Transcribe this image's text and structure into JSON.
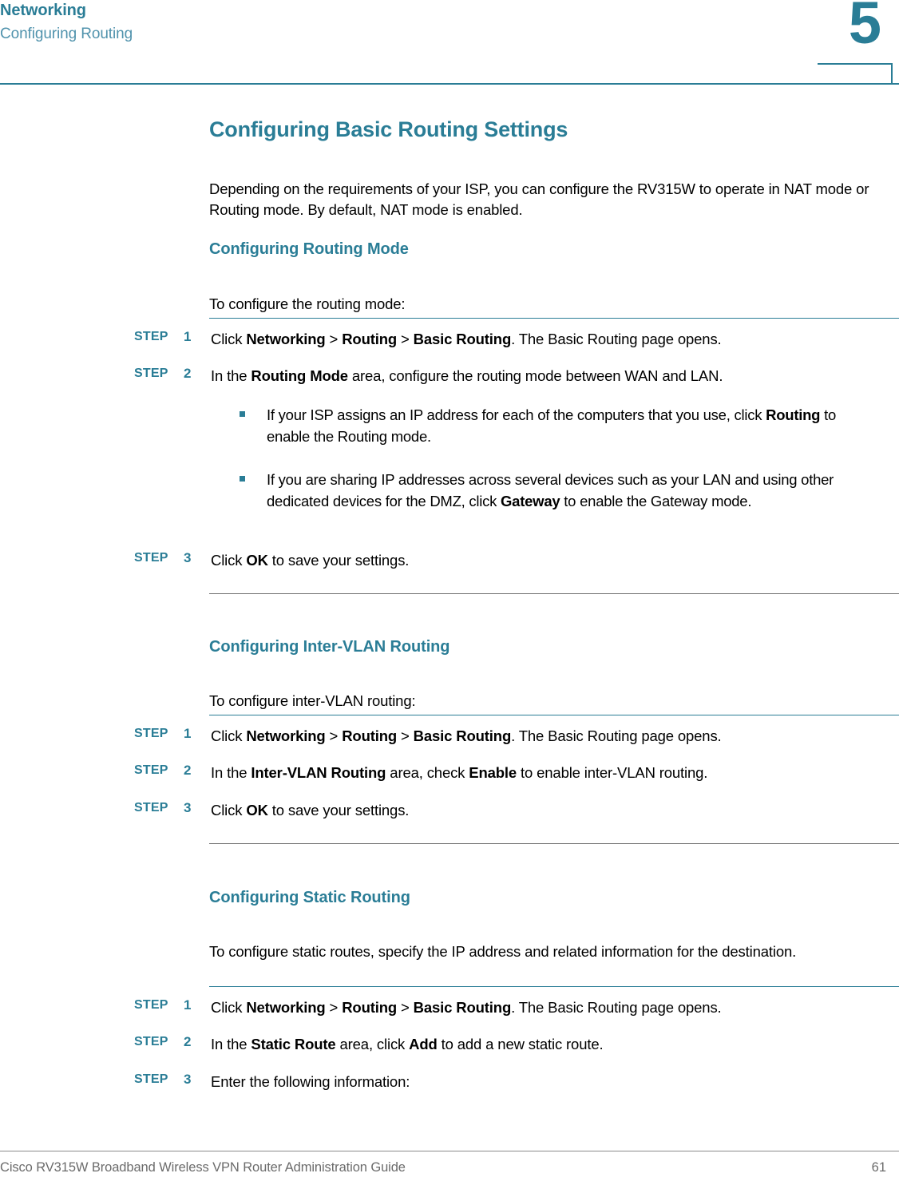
{
  "header": {
    "chapter_title": "Networking",
    "section_title": "Configuring Routing",
    "chapter_number": "5"
  },
  "colors": {
    "accent_teal": "#2a7d96",
    "accent_teal_light": "#5193ad",
    "rule_gray": "#6f6f6f",
    "footer_gray": "#6b6b6b"
  },
  "main": {
    "title": "Configuring Basic Routing Settings",
    "intro": "Depending on the requirements of your ISP, you can configure the RV315W to operate in NAT mode or Routing mode. By default, NAT mode is enabled.",
    "sections": [
      {
        "heading": "Configuring Routing Mode",
        "lead": "To configure the routing mode:",
        "steps": [
          {
            "label": "STEP",
            "number": "1",
            "text_html": "Click <b>Networking</b> > <b>Routing</b> > <b>Basic Routing</b>. The Basic Routing page opens."
          },
          {
            "label": "STEP",
            "number": "2",
            "text_html": "In the <b>Routing Mode</b> area, configure the routing mode between WAN and LAN."
          },
          {
            "label": "STEP",
            "number": "3",
            "text_html": "Click <b>OK</b> to save your settings."
          }
        ],
        "bullets": [
          "If your ISP assigns an IP address for each of the computers that you use, click <b>Routing</b> to enable the Routing mode.",
          "If you are sharing IP addresses across several devices such as your LAN and using other dedicated devices for the DMZ, click <b>Gateway</b> to enable the Gateway mode."
        ]
      },
      {
        "heading": "Configuring Inter-VLAN Routing",
        "lead": "To configure inter-VLAN routing:",
        "steps": [
          {
            "label": "STEP",
            "number": "1",
            "text_html": "Click <b>Networking</b> > <b>Routing</b> > <b>Basic Routing</b>. The Basic Routing page opens."
          },
          {
            "label": "STEP",
            "number": "2",
            "text_html": "In the <b>Inter-VLAN Routing</b> area, check <b>Enable</b> to enable inter-VLAN routing."
          },
          {
            "label": "STEP",
            "number": "3",
            "text_html": "Click <b>OK</b> to save your settings."
          }
        ],
        "bullets": []
      },
      {
        "heading": "Configuring Static Routing",
        "lead": "To configure static routes, specify the IP address and related information for the destination.",
        "steps": [
          {
            "label": "STEP",
            "number": "1",
            "text_html": "Click <b>Networking</b> > <b>Routing</b> > <b>Basic Routing</b>. The Basic Routing page opens."
          },
          {
            "label": "STEP",
            "number": "2",
            "text_html": "In the <b>Static Route</b> area, click <b>Add</b> to add a new static route."
          },
          {
            "label": "STEP",
            "number": "3",
            "text_html": "Enter the following information:"
          }
        ],
        "bullets": []
      }
    ]
  },
  "footer": {
    "guide_title": "Cisco RV315W Broadband Wireless VPN Router Administration Guide",
    "page_number": "61"
  }
}
